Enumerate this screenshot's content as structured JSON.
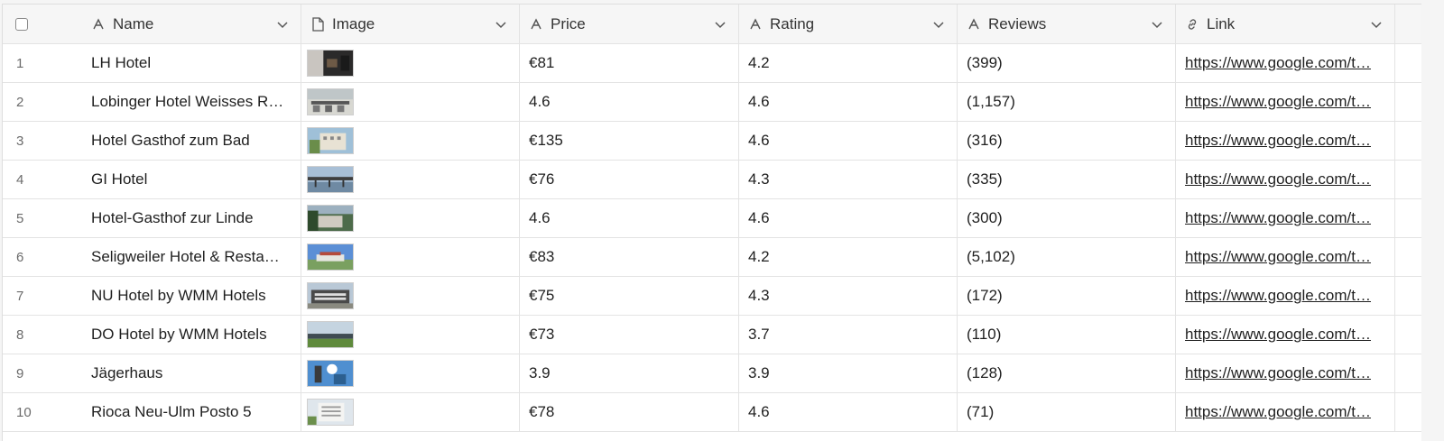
{
  "header": {
    "columns": [
      {
        "key": "name",
        "label": "Name",
        "icon": "text-field-icon"
      },
      {
        "key": "image",
        "label": "Image",
        "icon": "file-icon"
      },
      {
        "key": "price",
        "label": "Price",
        "icon": "text-field-icon"
      },
      {
        "key": "rating",
        "label": "Rating",
        "icon": "text-field-icon"
      },
      {
        "key": "reviews",
        "label": "Reviews",
        "icon": "text-field-icon"
      },
      {
        "key": "link",
        "label": "Link",
        "icon": "link-icon"
      }
    ]
  },
  "rows": [
    {
      "num": "1",
      "name": "LH Hotel",
      "price": "€81",
      "rating": "4.2",
      "reviews": "(399)",
      "link": "https://www.google.com/t…",
      "thumb": "dark"
    },
    {
      "num": "2",
      "name": "Lobinger Hotel Weisses R…",
      "price": "4.6",
      "rating": "4.6",
      "reviews": "(1,157)",
      "link": "https://www.google.com/t…",
      "thumb": "terrace"
    },
    {
      "num": "3",
      "name": "Hotel Gasthof zum Bad",
      "price": "€135",
      "rating": "4.6",
      "reviews": "(316)",
      "link": "https://www.google.com/t…",
      "thumb": "facade"
    },
    {
      "num": "4",
      "name": "GI Hotel",
      "price": "€76",
      "rating": "4.3",
      "reviews": "(335)",
      "link": "https://www.google.com/t…",
      "thumb": "bridge"
    },
    {
      "num": "5",
      "name": "Hotel-Gasthof zur Linde",
      "price": "4.6",
      "rating": "4.6",
      "reviews": "(300)",
      "link": "https://www.google.com/t…",
      "thumb": "green"
    },
    {
      "num": "6",
      "name": "Seligweiler Hotel & Resta…",
      "price": "€83",
      "rating": "4.2",
      "reviews": "(5,102)",
      "link": "https://www.google.com/t…",
      "thumb": "sky"
    },
    {
      "num": "7",
      "name": "NU Hotel by WMM Hotels",
      "price": "€75",
      "rating": "4.3",
      "reviews": "(172)",
      "link": "https://www.google.com/t…",
      "thumb": "building"
    },
    {
      "num": "8",
      "name": "DO Hotel by WMM Hotels",
      "price": "€73",
      "rating": "3.7",
      "reviews": "(110)",
      "link": "https://www.google.com/t…",
      "thumb": "field"
    },
    {
      "num": "9",
      "name": "Jägerhaus",
      "price": "3.9",
      "rating": "3.9",
      "reviews": "(128)",
      "link": "https://www.google.com/t…",
      "thumb": "blue"
    },
    {
      "num": "10",
      "name": "Rioca Neu-Ulm Posto 5",
      "price": "€78",
      "rating": "4.6",
      "reviews": "(71)",
      "link": "https://www.google.com/t…",
      "thumb": "modern"
    }
  ]
}
